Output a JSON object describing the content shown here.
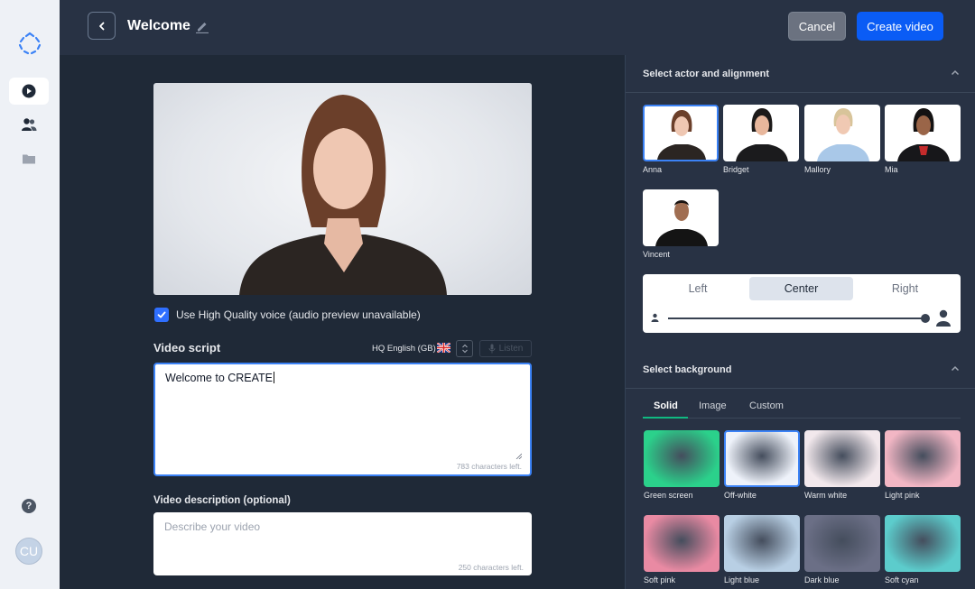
{
  "sidebar": {
    "items": [
      {
        "name": "videos",
        "icon": "play-icon",
        "active": true
      },
      {
        "name": "actors",
        "icon": "people-icon",
        "active": false
      },
      {
        "name": "files",
        "icon": "folder-icon",
        "active": false
      }
    ],
    "help_label": "?",
    "avatar_initials": "CU"
  },
  "header": {
    "title": "Welcome",
    "cancel_label": "Cancel",
    "create_label": "Create video"
  },
  "main": {
    "hq_voice_label": "Use High Quality voice (audio preview unavailable)",
    "hq_voice_checked": true,
    "script_label": "Video script",
    "language": "HQ English (GB)",
    "listen_label": "Listen",
    "script_value": "Welcome to CREATE",
    "script_chars_left": "783 characters left.",
    "description_label": "Video description (optional)",
    "description_placeholder": "Describe your video",
    "description_chars_left": "250 characters left."
  },
  "actors_section": {
    "title": "Select actor and alignment",
    "actors": [
      {
        "name": "Anna",
        "selected": true
      },
      {
        "name": "Bridget",
        "selected": false
      },
      {
        "name": "Mallory",
        "selected": false
      },
      {
        "name": "Mia",
        "selected": false
      },
      {
        "name": "Vincent",
        "selected": false
      }
    ],
    "alignment": {
      "options": [
        "Left",
        "Center",
        "Right"
      ],
      "selected": "Center",
      "size_level": 0.98
    }
  },
  "background_section": {
    "title": "Select background",
    "tabs": [
      "Solid",
      "Image",
      "Custom"
    ],
    "active_tab": "Solid",
    "swatches": [
      {
        "name": "Green screen",
        "color": "#2bd18b",
        "selected": false
      },
      {
        "name": "Off-white",
        "color": "#eef2fa",
        "selected": true
      },
      {
        "name": "Warm white",
        "color": "#f2e8ec",
        "selected": false
      },
      {
        "name": "Light pink",
        "color": "#f2b6c4",
        "selected": false
      },
      {
        "name": "Soft pink",
        "color": "#e98aa3",
        "selected": false
      },
      {
        "name": "Light blue",
        "color": "#b8cfe4",
        "selected": false
      },
      {
        "name": "Dark blue",
        "color": "#6b6f86",
        "selected": false
      },
      {
        "name": "Soft cyan",
        "color": "#5ccccc",
        "selected": false
      }
    ]
  },
  "colors": {
    "accent": "#0a5cf5",
    "background": "#1f2937",
    "panel": "#283244"
  }
}
